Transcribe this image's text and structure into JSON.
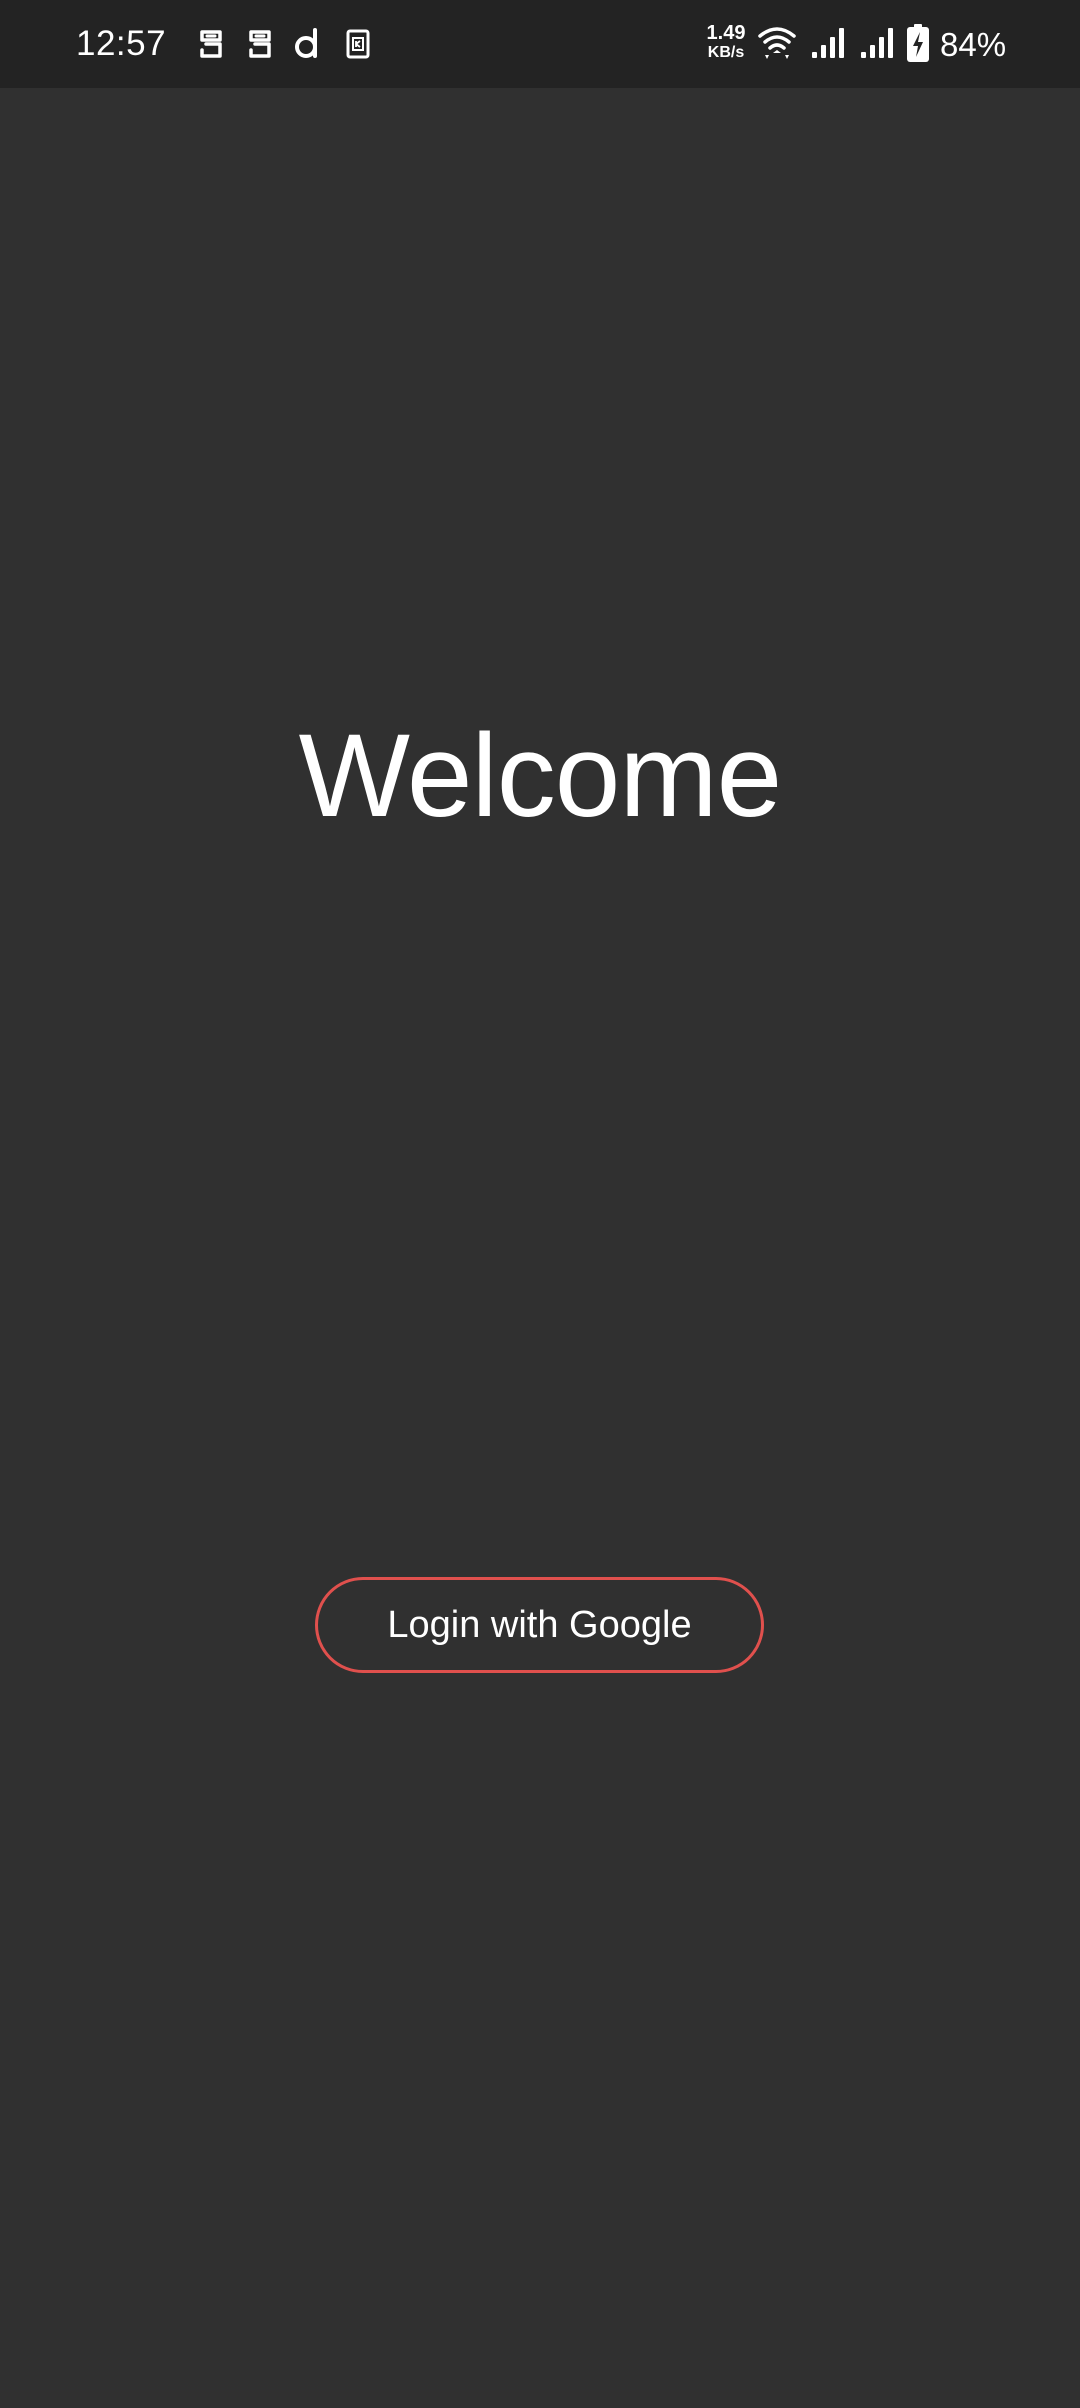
{
  "status_bar": {
    "time": "12:57",
    "notification_icons": [
      "app-notification-icon",
      "app-notification-icon",
      "d-app-icon",
      "sim-card-icon"
    ],
    "net_speed_value": "1.49",
    "net_speed_unit": "KB/s",
    "wifi_icon": "wifi-icon",
    "signal_icons": [
      "signal-icon",
      "signal-icon"
    ],
    "battery_icon": "battery-charging-icon",
    "battery_percent": "84%"
  },
  "main": {
    "title": "Welcome",
    "login_button_label": "Login with Google"
  },
  "colors": {
    "background": "#303030",
    "status_bar_background": "#232323",
    "button_border": "#e0504d",
    "text": "#ffffff"
  }
}
